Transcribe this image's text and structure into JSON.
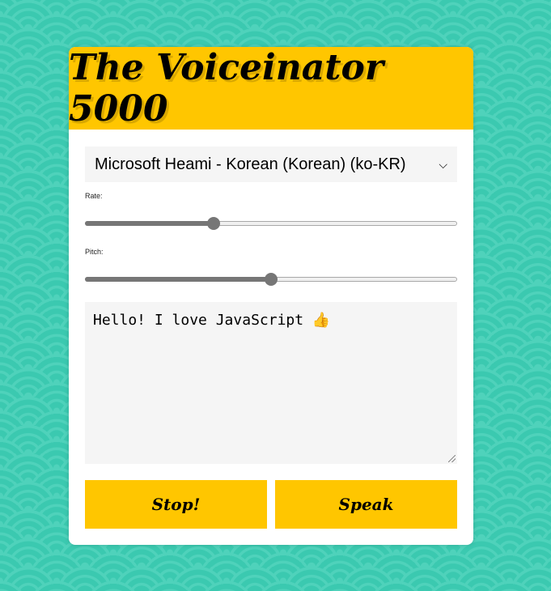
{
  "app": {
    "title": "The Voiceinator 5000"
  },
  "voice_select": {
    "selected": "Microsoft Heami - Korean (Korean) (ko-KR)",
    "icon": "chevron-down-icon"
  },
  "rate": {
    "label": "Rate:",
    "value_fraction": 0.345
  },
  "pitch": {
    "label": "Pitch:",
    "value_fraction": 0.5
  },
  "message": {
    "text": "Hello! I love JavaScript 👍"
  },
  "buttons": {
    "stop": "Stop!",
    "speak": "Speak"
  },
  "colors": {
    "accent": "#ffc600",
    "background": "#3bc9b0"
  }
}
